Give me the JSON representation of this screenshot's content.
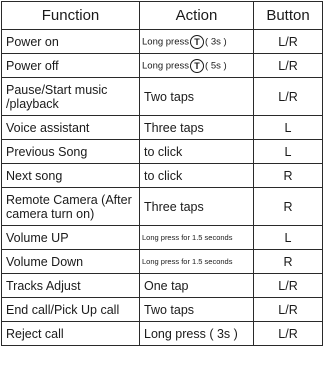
{
  "header": {
    "function": "Function",
    "action": "Action",
    "button": "Button"
  },
  "rows": [
    {
      "function": "Power on",
      "action_pre": "Long press",
      "icon_letter": "T",
      "action_post": "( 3s )",
      "button": "L/R"
    },
    {
      "function": "Power off",
      "action_pre": "Long press",
      "icon_letter": "T",
      "action_post": "( 5s )",
      "button": "L/R"
    },
    {
      "function": "Pause/Start music /playback",
      "action": "Two taps",
      "button": "L/R"
    },
    {
      "function": "Voice assistant",
      "action": "Three taps",
      "button": "L"
    },
    {
      "function": "Previous Song",
      "action": "to click",
      "button": "L"
    },
    {
      "function": "Next song",
      "action": "to click",
      "button": "R"
    },
    {
      "function": "Remote Camera (After camera turn on)",
      "action": "Three taps",
      "button": "R"
    },
    {
      "function": "Volume UP",
      "action": "Long press for 1.5 seconds",
      "button": "L"
    },
    {
      "function": "Volume Down",
      "action": "Long press for 1.5 seconds",
      "button": "R"
    },
    {
      "function": "Tracks Adjust",
      "action": "One tap",
      "button": "L/R"
    },
    {
      "function": "End call/Pick Up call",
      "action": "Two taps",
      "button": "L/R"
    },
    {
      "function": "Reject call",
      "action": "Long press ( 3s )",
      "button": "L/R"
    }
  ]
}
